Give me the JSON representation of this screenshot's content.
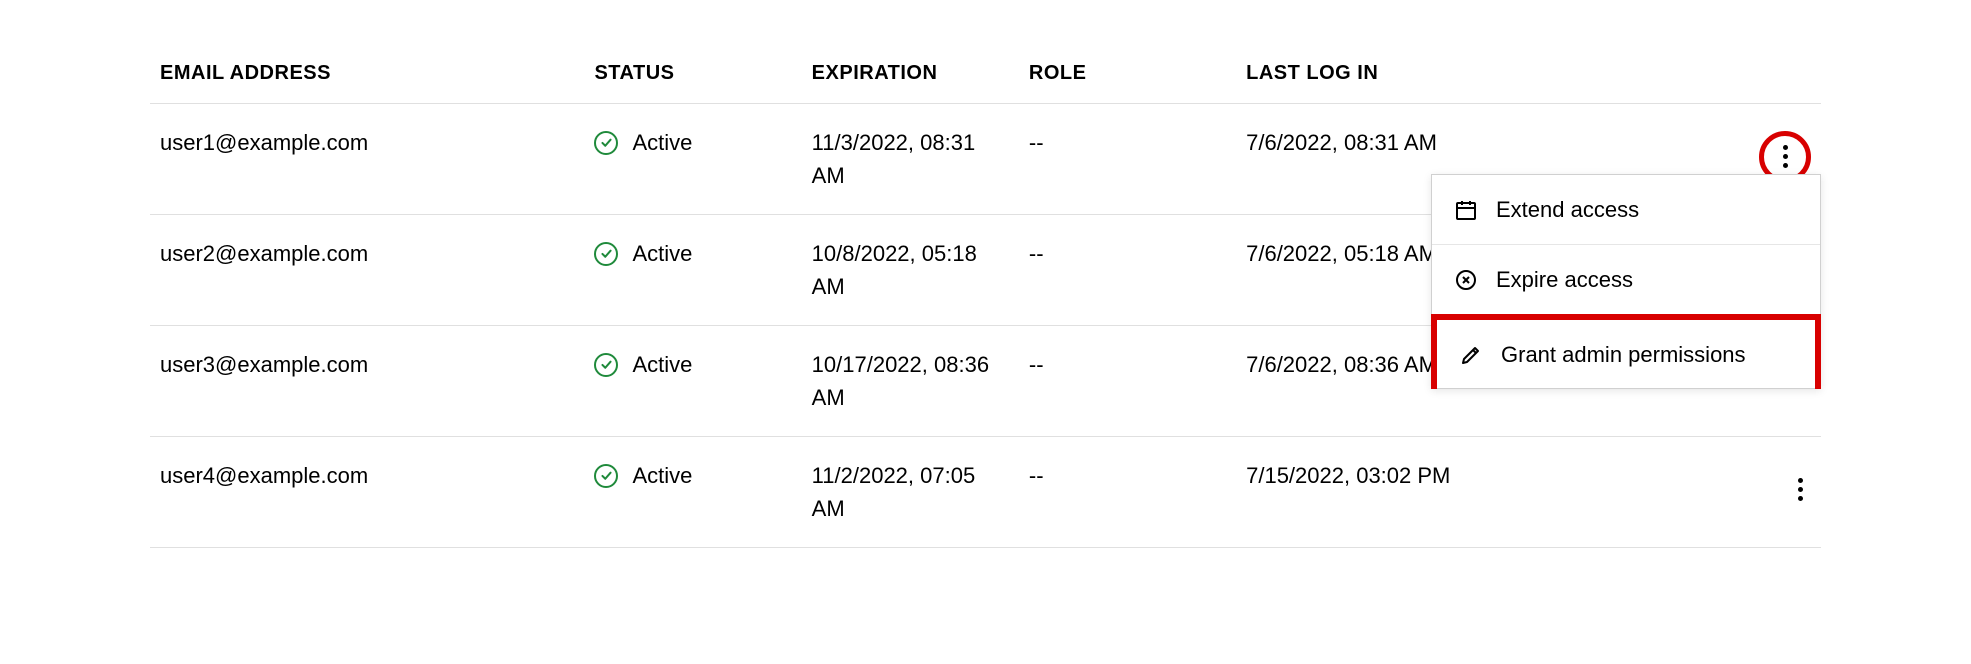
{
  "columns": {
    "email": "EMAIL ADDRESS",
    "status": "STATUS",
    "expiration": "EXPIRATION",
    "role": "ROLE",
    "lastlogin": "LAST LOG IN"
  },
  "rows": [
    {
      "email": "user1@example.com",
      "status": "Active",
      "expiration": "11/3/2022, 08:31 AM",
      "role": "--",
      "lastlogin": "7/6/2022, 08:31 AM"
    },
    {
      "email": "user2@example.com",
      "status": "Active",
      "expiration": "10/8/2022, 05:18 AM",
      "role": "--",
      "lastlogin": "7/6/2022, 05:18 AM"
    },
    {
      "email": "user3@example.com",
      "status": "Active",
      "expiration": "10/17/2022, 08:36 AM",
      "role": "--",
      "lastlogin": "7/6/2022, 08:36 AM"
    },
    {
      "email": "user4@example.com",
      "status": "Active",
      "expiration": "11/2/2022, 07:05 AM",
      "role": "--",
      "lastlogin": "7/15/2022, 03:02 PM"
    }
  ],
  "menu": {
    "extend": "Extend access",
    "expire": "Expire access",
    "grant": "Grant admin permissions"
  }
}
